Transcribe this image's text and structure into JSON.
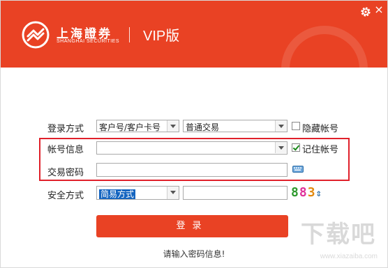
{
  "header": {
    "brand_cn": "上海證券",
    "brand_en": "SHANGHAI SECURITIES",
    "product": "VIP版",
    "close_glyph": "×"
  },
  "form": {
    "login_type_label": "登录方式",
    "login_type_value": "客户号/客户卡号",
    "trade_type_value": "普通交易",
    "hide_account_label": "隐藏帐号",
    "account_label": "帐号信息",
    "account_value": "",
    "remember_label": "记住帐号",
    "password_label": "交易密码",
    "password_value": "",
    "security_label": "安全方式",
    "security_value": "简易方式",
    "captcha_input_value": "",
    "captcha_digits": [
      "8",
      "8",
      "3"
    ],
    "captcha_colors": [
      "#2e9a2e",
      "#e0329a",
      "#e38a10"
    ],
    "captcha_refresh_glyph": "⇕"
  },
  "login_button": "登录",
  "status_text": "请输入密码信息!",
  "watermark": {
    "text": "下载吧",
    "url": "www.xiazaiba.com"
  },
  "colors": {
    "accent": "#e94224",
    "highlight_border": "#e0202a",
    "selection": "#1565c0"
  },
  "icons": [
    "logo-icon",
    "gear-icon",
    "close-icon",
    "keyboard-icon",
    "refresh-icon"
  ]
}
